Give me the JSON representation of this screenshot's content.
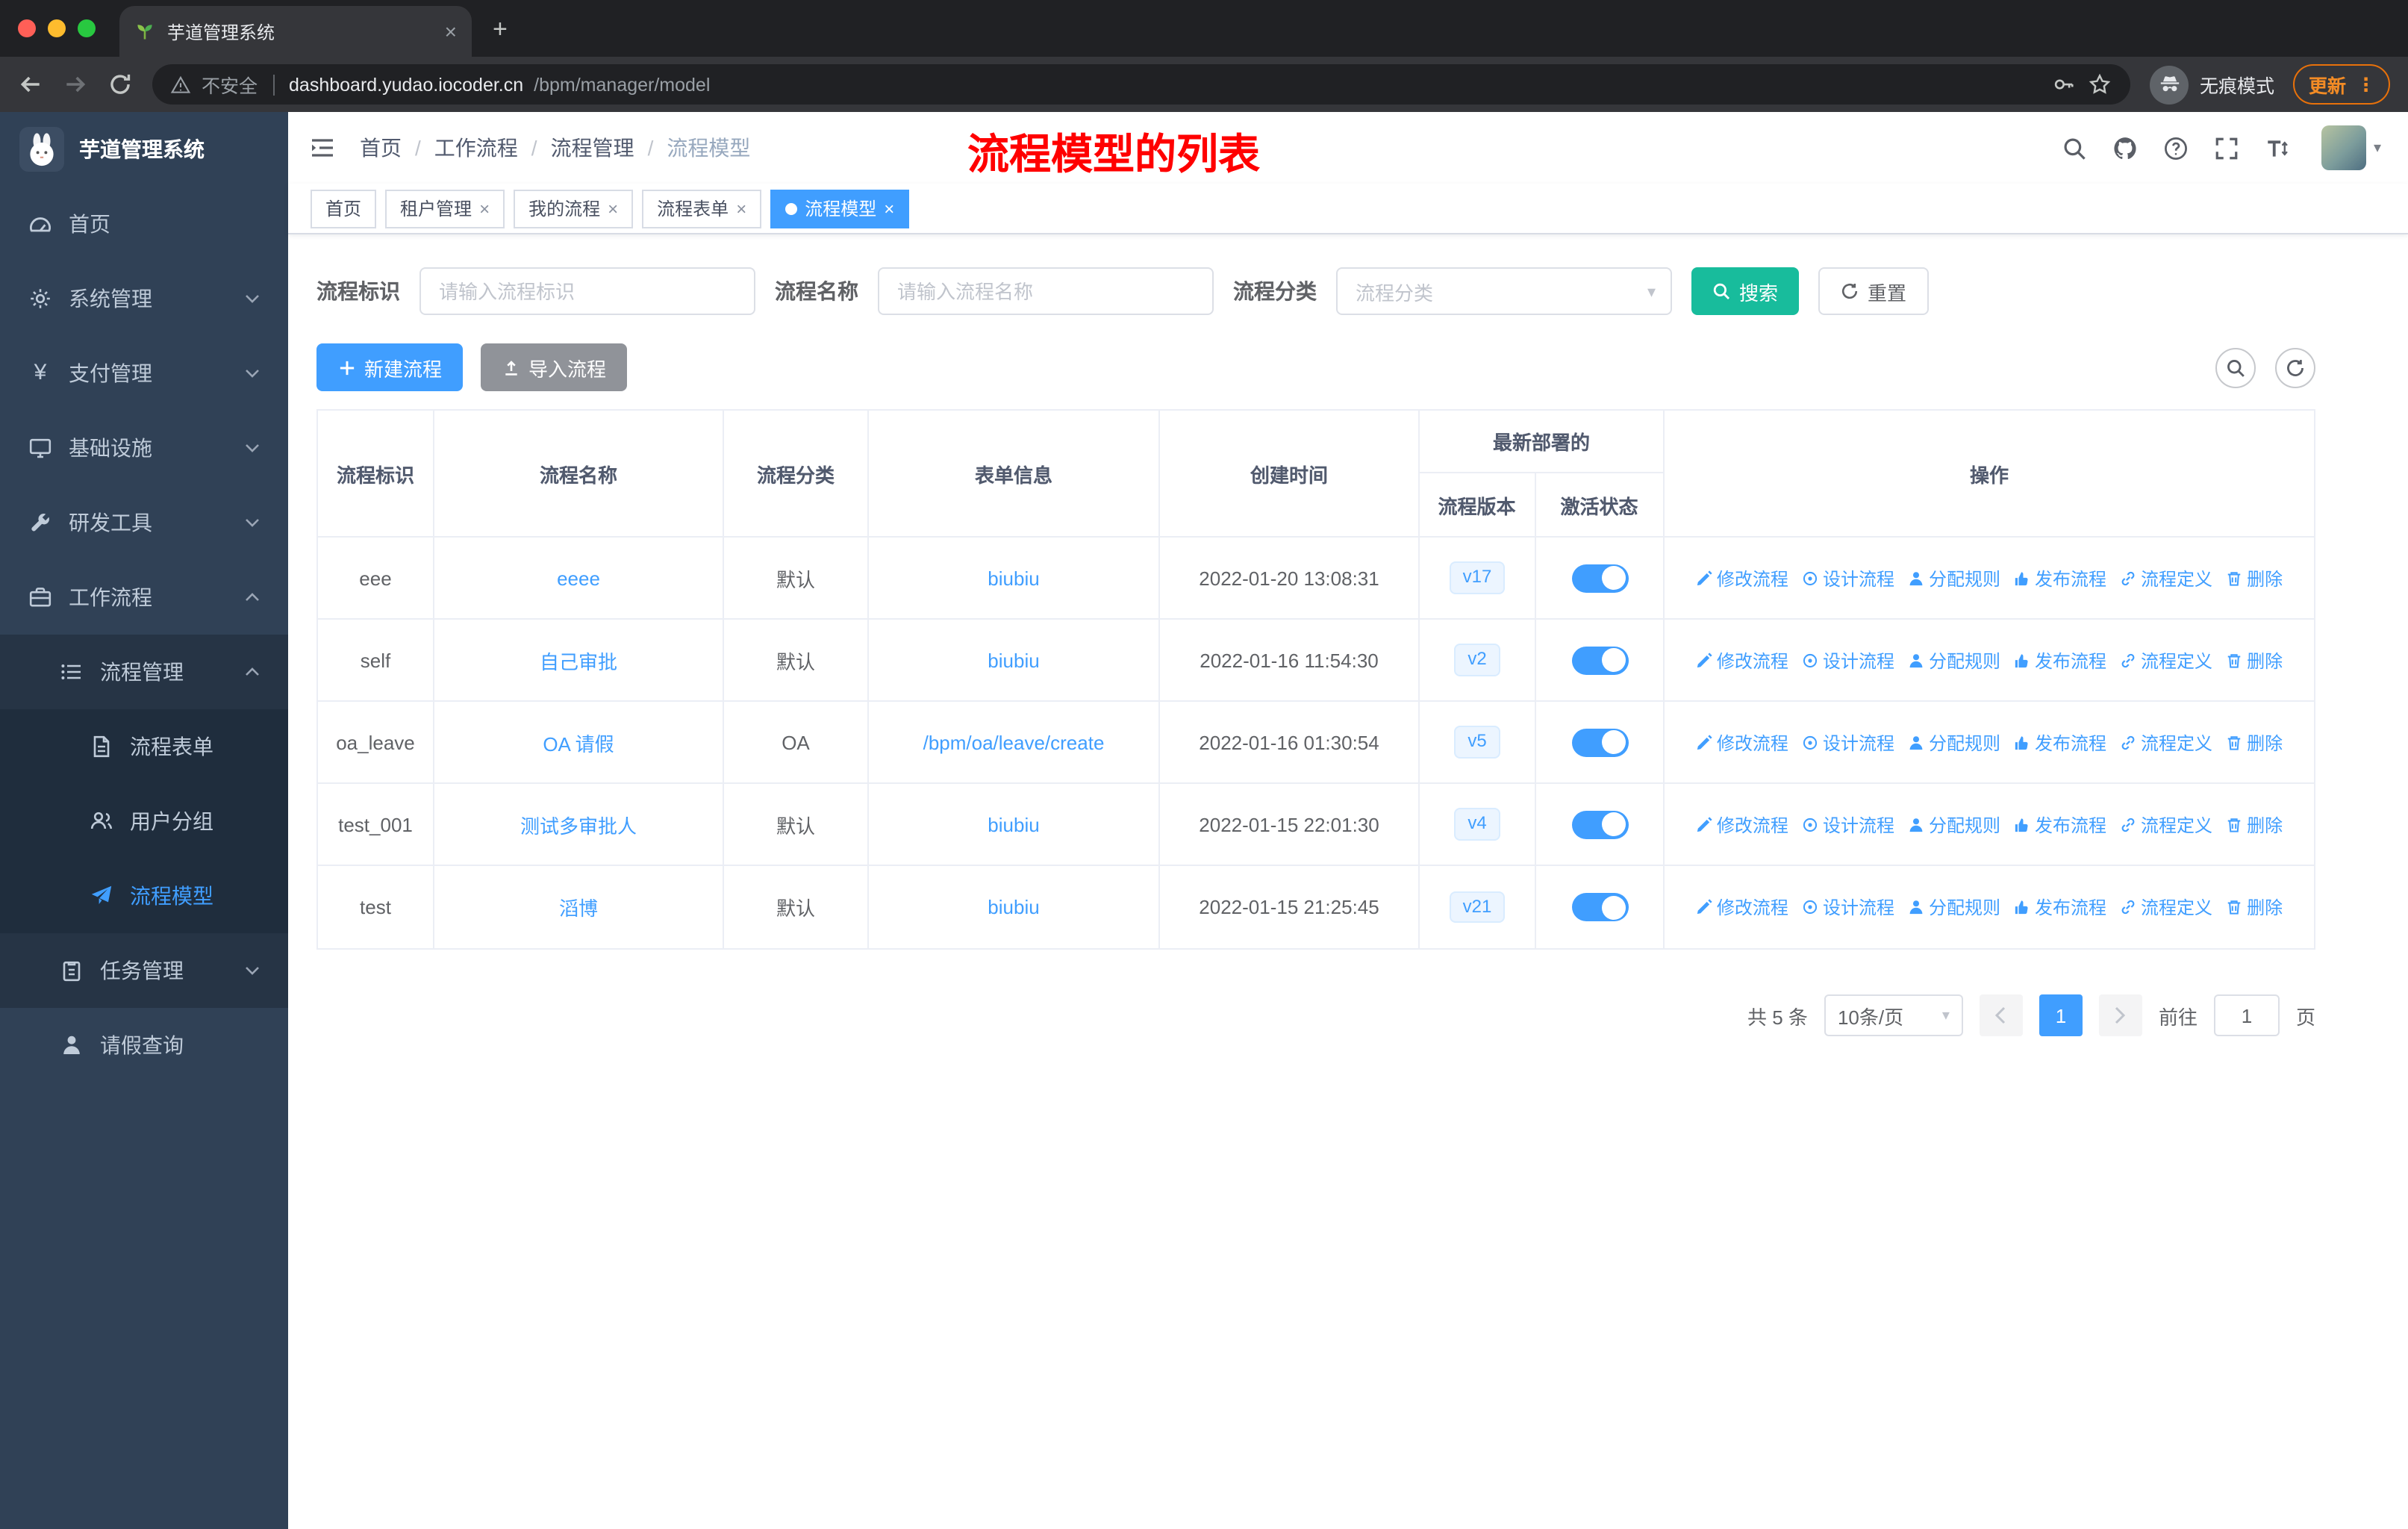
{
  "browser": {
    "tab_title": "芋道管理系统",
    "security_label": "不安全",
    "url_host": "dashboard.yudao.iocoder.cn",
    "url_path": "/bpm/manager/model",
    "incognito_label": "无痕模式",
    "update_label": "更新"
  },
  "sidebar": {
    "logo_title": "芋道管理系统",
    "items": [
      {
        "label": "首页"
      },
      {
        "label": "系统管理"
      },
      {
        "label": "支付管理"
      },
      {
        "label": "基础设施"
      },
      {
        "label": "研发工具"
      },
      {
        "label": "工作流程"
      },
      {
        "label": "流程管理"
      },
      {
        "label": "流程表单"
      },
      {
        "label": "用户分组"
      },
      {
        "label": "流程模型"
      },
      {
        "label": "任务管理"
      },
      {
        "label": "请假查询"
      }
    ]
  },
  "header": {
    "breadcrumb": [
      "首页",
      "工作流程",
      "流程管理",
      "流程模型"
    ],
    "separator": "/",
    "annotation": "流程模型的列表"
  },
  "tags": [
    {
      "label": "首页"
    },
    {
      "label": "租户管理"
    },
    {
      "label": "我的流程"
    },
    {
      "label": "流程表单"
    },
    {
      "label": "流程模型"
    }
  ],
  "filters": {
    "id_label": "流程标识",
    "id_placeholder": "请输入流程标识",
    "name_label": "流程名称",
    "name_placeholder": "请输入流程名称",
    "category_label": "流程分类",
    "category_placeholder": "流程分类",
    "search_label": "搜索",
    "reset_label": "重置"
  },
  "toolbar": {
    "create_label": "新建流程",
    "import_label": "导入流程"
  },
  "table": {
    "headers": {
      "id": "流程标识",
      "name": "流程名称",
      "category": "流程分类",
      "form": "表单信息",
      "created": "创建时间",
      "deploy_group": "最新部署的",
      "version": "流程版本",
      "status": "激活状态",
      "actions": "操作"
    },
    "action_labels": [
      "修改流程",
      "设计流程",
      "分配规则",
      "发布流程",
      "流程定义",
      "删除"
    ],
    "rows": [
      {
        "id": "eee",
        "name": "eeee",
        "category": "默认",
        "form": "biubiu",
        "created": "2022-01-20 13:08:31",
        "version": "v17",
        "active": true
      },
      {
        "id": "self",
        "name": "自己审批",
        "category": "默认",
        "form": "biubiu",
        "created": "2022-01-16 11:54:30",
        "version": "v2",
        "active": true
      },
      {
        "id": "oa_leave",
        "name": "OA 请假",
        "category": "OA",
        "form": "/bpm/oa/leave/create",
        "created": "2022-01-16 01:30:54",
        "version": "v5",
        "active": true
      },
      {
        "id": "test_001",
        "name": "测试多审批人",
        "category": "默认",
        "form": "biubiu",
        "created": "2022-01-15 22:01:30",
        "version": "v4",
        "active": true
      },
      {
        "id": "test",
        "name": "滔博",
        "category": "默认",
        "form": "biubiu",
        "created": "2022-01-15 21:25:45",
        "version": "v21",
        "active": true
      }
    ]
  },
  "pagination": {
    "total": "共 5 条",
    "page_size": "10条/页",
    "page": "1",
    "goto_label": "前往",
    "goto_value": "1",
    "unit_label": "页"
  },
  "colors": {
    "primary": "#409EFF",
    "search_button": "#18BC9C",
    "annotation_red": "#FF0000",
    "sidebar_bg": "#304156",
    "toggle_on": "#409EFF"
  }
}
